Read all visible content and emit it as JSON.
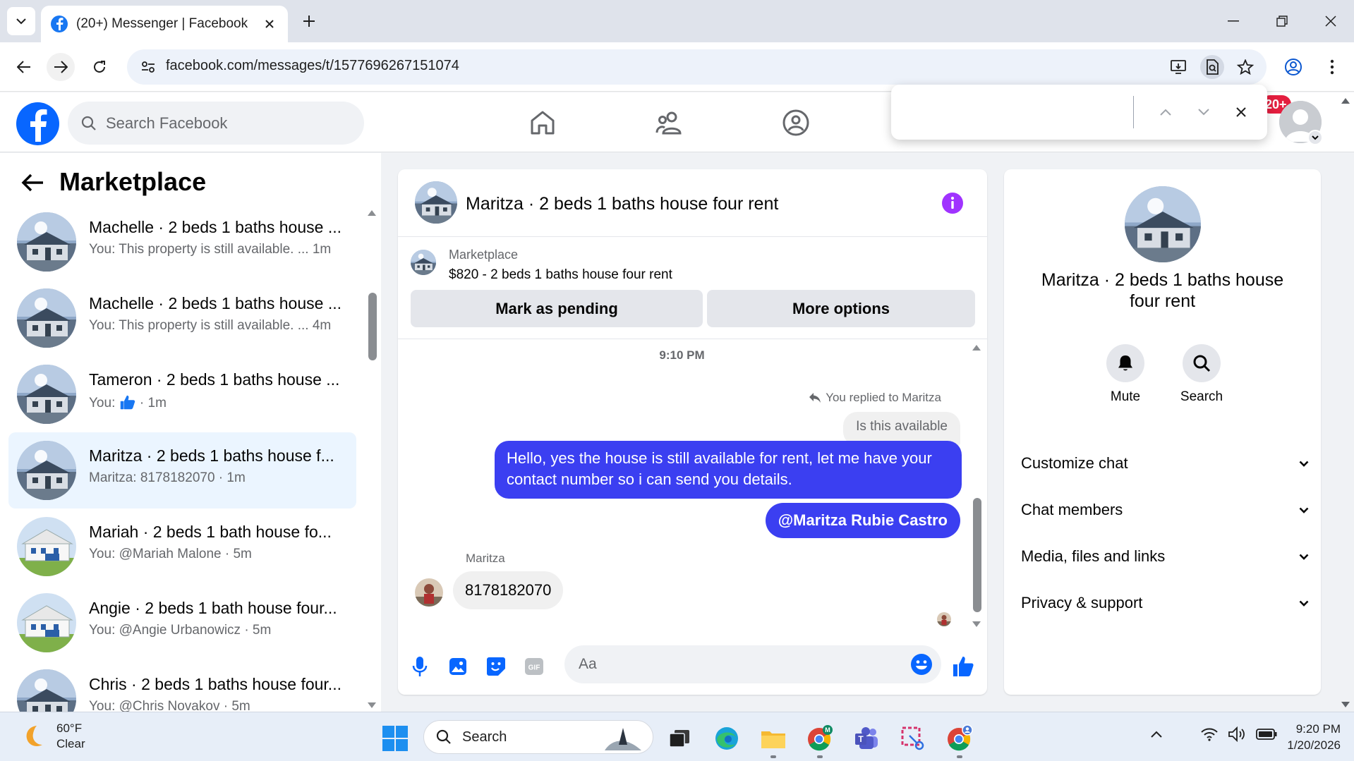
{
  "browser": {
    "tab_title": "(20+) Messenger | Facebook",
    "url": "facebook.com/messages/t/1577696267151074"
  },
  "fb": {
    "search_placeholder": "Search Facebook",
    "notification_badge": "20+"
  },
  "left_panel": {
    "title": "Marketplace",
    "conversations": [
      {
        "name": "Machelle · 2 beds 1 baths house ...",
        "preview": "You: This property is still available. ...  1m",
        "thumb": "house-dark"
      },
      {
        "name": "Machelle · 2 beds 1 baths house ...",
        "preview": "You: This property is still available. ...  4m",
        "thumb": "house-dark"
      },
      {
        "name": "Tameron · 2 beds 1 baths house ...",
        "preview_prefix": "You:",
        "preview_suffix": "· 1m",
        "thumb": "house-dark"
      },
      {
        "name": "Maritza · 2 beds 1 baths house f...",
        "preview": "Maritza: 8178182070 · 1m",
        "thumb": "house-dark",
        "active": true
      },
      {
        "name": "Mariah · 2 beds 1 bath house fo...",
        "preview": "You: @Mariah Malone · 5m",
        "thumb": "house-white"
      },
      {
        "name": "Angie · 2 beds 1 bath house four...",
        "preview": "You: @Angie Urbanowicz · 5m",
        "thumb": "house-white"
      },
      {
        "name": "Chris · 2 beds 1 baths house four...",
        "preview": "You: @Chris Novakov · 5m",
        "thumb": "house-dark"
      }
    ]
  },
  "chat": {
    "title": "Maritza · 2 beds 1 baths house four rent",
    "listing": {
      "source": "Marketplace",
      "title": "$820 - 2 beds 1 baths house four rent",
      "mark_pending": "Mark as pending",
      "more_options": "More options"
    },
    "time": "9:10 PM",
    "reply_note": "You replied to Maritza",
    "replied_text": "Is this available",
    "sent_message_1": "Hello, yes the house is still available for rent, let me have your contact number so i can send you details.",
    "sent_message_2": "@Maritza Rubie Castro",
    "received_name": "Maritza",
    "received_message": "8178182070",
    "input_placeholder": "Aa"
  },
  "info_panel": {
    "name": "Maritza · 2 beds 1 baths house four rent",
    "mute": "Mute",
    "search": "Search",
    "sections": [
      "Customize chat",
      "Chat members",
      "Media, files and links",
      "Privacy & support"
    ]
  },
  "taskbar": {
    "temperature": "60°F",
    "condition": "Clear",
    "search_label": "Search",
    "time": "9:20 PM",
    "date": "1/20/2026"
  },
  "colors": {
    "fb_blue": "#0866ff",
    "bubble_sent": "#3b3ff1",
    "info_purple": "#a033ff",
    "active_row": "#ebf5ff"
  }
}
